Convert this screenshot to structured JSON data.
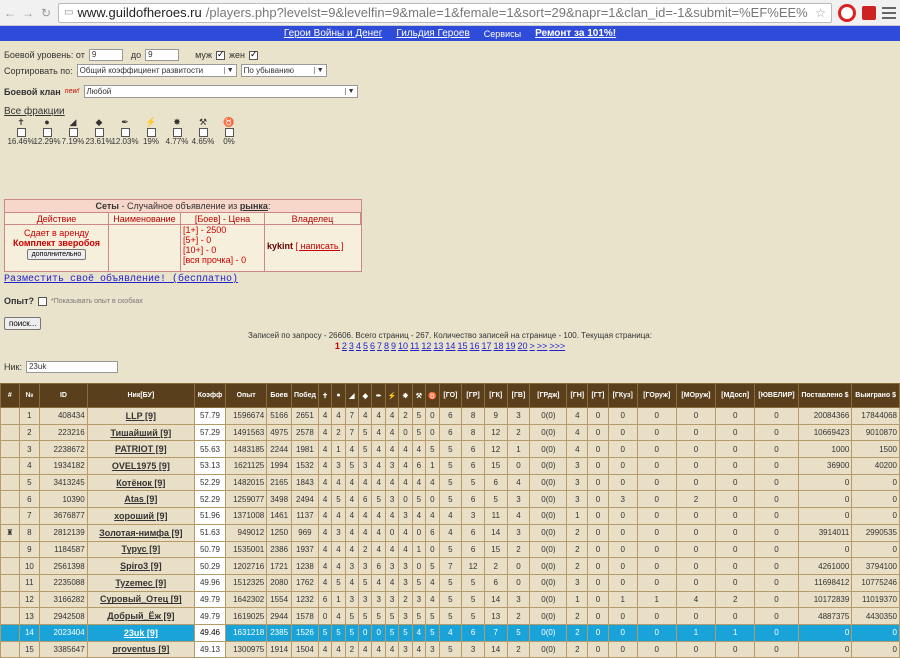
{
  "browser": {
    "url_host": "www.guildofheroes.ru",
    "url_path": "/players.php?levelst=9&levelfin=9&male=1&female=1&sort=29&napr=1&clan_id=-1&submit=%EF%EE%"
  },
  "sitebar": {
    "items": [
      "Герои Войны и Денег",
      "Гильдия Героев",
      "Сервисы",
      "Ремонт за 101%!"
    ]
  },
  "filters": {
    "level_label": "Боевой уровень: от",
    "level_from": "9",
    "level_to_label": "до",
    "level_to": "9",
    "male_label": "муж",
    "female_label": "жен",
    "sort_label": "Сортировать по:",
    "sort_value": "Общий коэффициент развитости",
    "order_value": "По убыванию",
    "clan_label": "Боевой клан",
    "clan_new": "new!",
    "clan_value": "Любой",
    "factions_link": "Все фракции",
    "factions": [
      {
        "icon": "✝",
        "pct": "16.46%"
      },
      {
        "icon": "●",
        "pct": "12.29%"
      },
      {
        "icon": "◢",
        "pct": "7.19%"
      },
      {
        "icon": "◆",
        "pct": "23.61%"
      },
      {
        "icon": "✒",
        "pct": "12.03%"
      },
      {
        "icon": "⚡",
        "pct": "19%"
      },
      {
        "icon": "✸",
        "pct": "4.77%"
      },
      {
        "icon": "⚒",
        "pct": "4.65%"
      },
      {
        "icon": "♉",
        "pct": "0%"
      }
    ]
  },
  "market": {
    "title_a": "Сеты",
    "title_b": " - Случайное объявление из ",
    "title_link": "рынка",
    "cols": [
      "Действие",
      "Наименование",
      "[Боев] - Цена",
      "Владелец"
    ],
    "action": "Сдает в аренду",
    "item": "Комплект зверобоя",
    "more_btn": "дополнительно",
    "prices": [
      "[1+] - 2500",
      "[5+] - 0",
      "[10+] - 0",
      "[вся прочка] - 0"
    ],
    "owner": "kykint",
    "write": "[ написать ]"
  },
  "place_ad": "Разместить своё объявление! (бесплатно)",
  "exp_label": "Опыт?",
  "exp_hint": "*Показывать опыт в скобках",
  "search_btn": "поиск...",
  "records": "Записей по запросу - 26606. Всего страниц - 267. Количество записей на странице - 100. Текущая страница:",
  "pages": [
    "1",
    "2",
    "3",
    "4",
    "5",
    "6",
    "7",
    "8",
    "9",
    "10",
    "11",
    "12",
    "13",
    "14",
    "15",
    "16",
    "17",
    "18",
    "19",
    "20",
    ">",
    ">>",
    ">>>"
  ],
  "nick_label": "Ник:",
  "nick_value": "23uk",
  "table": {
    "headers": [
      "#",
      "№",
      "ID",
      "Ник[БУ]",
      "Коэфф",
      "Опыт",
      "Боев",
      "Побед",
      "✝",
      "●",
      "◢",
      "◆",
      "✒",
      "⚡",
      "✸",
      "⚒",
      "♉",
      "[ГО]",
      "[ГР]",
      "[ГК]",
      "[ГВ]",
      "[ГРдж]",
      "[ГН]",
      "[ГТ]",
      "[ГКуз]",
      "[ГОруж]",
      "[МОруж]",
      "[МДосп]",
      "[ЮВЕЛИР]",
      "Поставлено $",
      "Выиграно $"
    ],
    "rows": [
      [
        "",
        "1",
        "408434",
        "LLP [9]",
        "57.79",
        "1596674",
        "5166",
        "2651",
        "4",
        "4",
        "7",
        "4",
        "4",
        "4",
        "2",
        "5",
        "0",
        "6",
        "8",
        "9",
        "3",
        "0(0)",
        "4",
        "0",
        "0",
        "0",
        "0",
        "0",
        "0",
        "20084366",
        "17844068"
      ],
      [
        "",
        "2",
        "223216",
        "Тишайший [9]",
        "57.29",
        "1491563",
        "4975",
        "2578",
        "4",
        "2",
        "7",
        "5",
        "4",
        "4",
        "0",
        "5",
        "0",
        "6",
        "8",
        "12",
        "2",
        "0(0)",
        "4",
        "0",
        "0",
        "0",
        "0",
        "0",
        "0",
        "10669423",
        "9010870"
      ],
      [
        "",
        "3",
        "2238672",
        "PATRIOT [9]",
        "55.63",
        "1483185",
        "2244",
        "1981",
        "4",
        "1",
        "4",
        "5",
        "4",
        "4",
        "4",
        "4",
        "5",
        "5",
        "6",
        "12",
        "1",
        "0(0)",
        "4",
        "0",
        "0",
        "0",
        "0",
        "0",
        "0",
        "1000",
        "1500"
      ],
      [
        "",
        "4",
        "1934182",
        "OVEL1975 [9]",
        "53.13",
        "1621125",
        "1994",
        "1532",
        "4",
        "3",
        "5",
        "3",
        "4",
        "3",
        "4",
        "6",
        "1",
        "5",
        "6",
        "15",
        "0",
        "0(0)",
        "3",
        "0",
        "0",
        "0",
        "0",
        "0",
        "0",
        "36900",
        "40200"
      ],
      [
        "",
        "5",
        "3413245",
        "Котёнок [9]",
        "52.29",
        "1482015",
        "2165",
        "1843",
        "4",
        "4",
        "4",
        "4",
        "4",
        "4",
        "4",
        "4",
        "4",
        "5",
        "5",
        "6",
        "4",
        "0(0)",
        "3",
        "0",
        "0",
        "0",
        "0",
        "0",
        "0",
        "0",
        "0"
      ],
      [
        "",
        "6",
        "10390",
        "Atas [9]",
        "52.29",
        "1259077",
        "3498",
        "2494",
        "4",
        "5",
        "4",
        "6",
        "5",
        "3",
        "0",
        "5",
        "0",
        "5",
        "6",
        "5",
        "3",
        "0(0)",
        "3",
        "0",
        "3",
        "0",
        "2",
        "0",
        "0",
        "0",
        "0"
      ],
      [
        "",
        "7",
        "3676877",
        "хороший [9]",
        "51.96",
        "1371008",
        "1461",
        "1137",
        "4",
        "4",
        "4",
        "4",
        "4",
        "4",
        "3",
        "4",
        "4",
        "4",
        "3",
        "11",
        "4",
        "0(0)",
        "1",
        "0",
        "0",
        "0",
        "0",
        "0",
        "0",
        "0",
        "0"
      ],
      [
        "♜",
        "8",
        "2812139",
        "Золотая-нимфа [9]",
        "51.63",
        "949012",
        "1250",
        "969",
        "4",
        "3",
        "4",
        "4",
        "4",
        "0",
        "4",
        "0",
        "6",
        "4",
        "6",
        "14",
        "3",
        "0(0)",
        "2",
        "0",
        "0",
        "0",
        "0",
        "0",
        "0",
        "3914011",
        "2990535"
      ],
      [
        "",
        "9",
        "1184587",
        "Турус [9]",
        "50.79",
        "1535001",
        "2386",
        "1937",
        "4",
        "4",
        "4",
        "2",
        "4",
        "4",
        "4",
        "1",
        "0",
        "5",
        "6",
        "15",
        "2",
        "0(0)",
        "2",
        "0",
        "0",
        "0",
        "0",
        "0",
        "0",
        "0",
        "0"
      ],
      [
        "",
        "10",
        "2561398",
        "Spiro3 [9]",
        "50.29",
        "1202716",
        "1721",
        "1238",
        "4",
        "4",
        "3",
        "3",
        "6",
        "3",
        "3",
        "0",
        "5",
        "7",
        "12",
        "2",
        "0",
        "0(0)",
        "2",
        "0",
        "0",
        "0",
        "0",
        "0",
        "0",
        "4261000",
        "3794100"
      ],
      [
        "",
        "11",
        "2235088",
        "Tyzemec [9]",
        "49.96",
        "1512325",
        "2080",
        "1762",
        "4",
        "5",
        "4",
        "5",
        "4",
        "4",
        "3",
        "5",
        "4",
        "5",
        "5",
        "6",
        "0",
        "0(0)",
        "3",
        "0",
        "0",
        "0",
        "0",
        "0",
        "0",
        "11698412",
        "10775246"
      ],
      [
        "",
        "12",
        "3166282",
        "Суровый_Отец [9]",
        "49.79",
        "1642302",
        "1554",
        "1232",
        "6",
        "1",
        "3",
        "3",
        "3",
        "3",
        "2",
        "3",
        "4",
        "5",
        "5",
        "14",
        "3",
        "0(0)",
        "1",
        "0",
        "1",
        "1",
        "4",
        "2",
        "0",
        "10172839",
        "11019370"
      ],
      [
        "",
        "13",
        "2942508",
        "Добрый_Ёж [9]",
        "49.79",
        "1619025",
        "2944",
        "1578",
        "0",
        "4",
        "5",
        "5",
        "5",
        "5",
        "3",
        "5",
        "5",
        "5",
        "5",
        "13",
        "2",
        "0(0)",
        "2",
        "0",
        "0",
        "0",
        "0",
        "0",
        "0",
        "4887375",
        "4430350"
      ],
      [
        "",
        "14",
        "2023404",
        "23uk [9]",
        "49.46",
        "1631218",
        "2385",
        "1526",
        "5",
        "5",
        "5",
        "0",
        "0",
        "5",
        "5",
        "4",
        "5",
        "4",
        "6",
        "7",
        "5",
        "0(0)",
        "2",
        "0",
        "0",
        "0",
        "1",
        "1",
        "0",
        "0",
        "0"
      ],
      [
        "",
        "15",
        "3385647",
        "proventus [9]",
        "49.13",
        "1300975",
        "1914",
        "1504",
        "4",
        "4",
        "2",
        "4",
        "4",
        "4",
        "3",
        "4",
        "3",
        "5",
        "3",
        "14",
        "2",
        "0(0)",
        "2",
        "0",
        "0",
        "0",
        "0",
        "0",
        "0",
        "0",
        "0"
      ]
    ]
  }
}
